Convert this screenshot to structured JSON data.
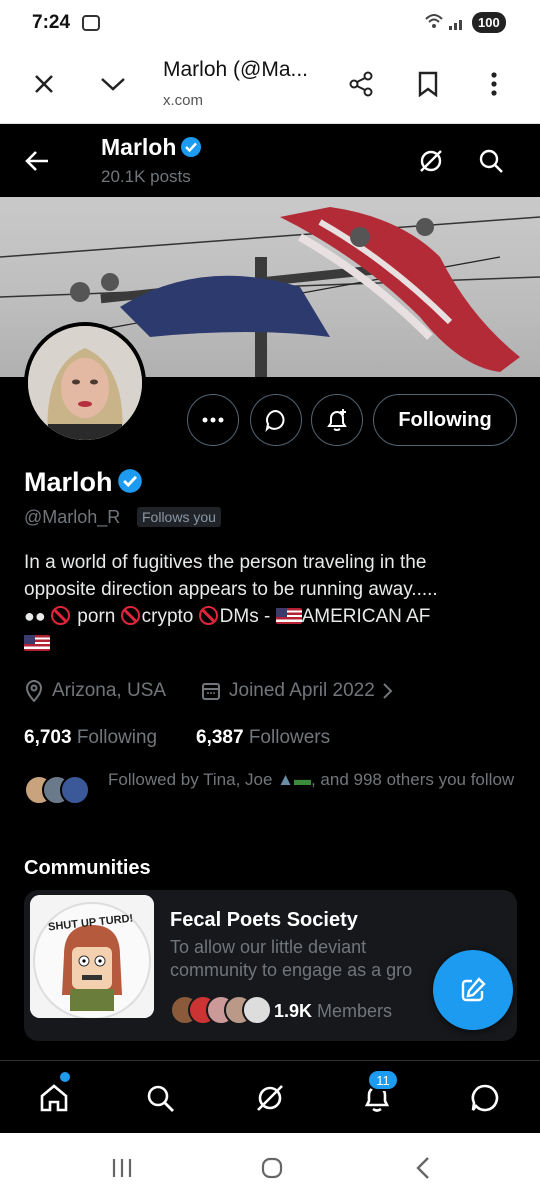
{
  "status_bar": {
    "time": "7:24",
    "battery": "100"
  },
  "browser": {
    "title": "Marloh (@Ma...",
    "url": "x.com"
  },
  "header": {
    "name": "Marloh",
    "posts": "20.1K posts"
  },
  "profile": {
    "name": "Marloh",
    "handle": "@Marloh_R",
    "follows_you": "Follows you",
    "following_button": "Following",
    "bio_line1": "In a world of fugitives the person traveling in the",
    "bio_line2": "opposite direction appears to be running away.....",
    "bio_porn": " porn ",
    "bio_crypto": "crypto ",
    "bio_dms": "DMs - ",
    "bio_american": "AMERICAN AF",
    "location": "Arizona, USA",
    "joined": "Joined April 2022",
    "following_count": "6,703",
    "following_label": "Following",
    "followers_count": "6,387",
    "followers_label": "Followers",
    "followed_by_prefix": "Followed by Tina, Joe ",
    "followed_by_suffix": ", and 998 others you follow"
  },
  "communities": {
    "heading": "Communities",
    "card": {
      "title": "Fecal Poets Society",
      "description_line1": "To allow our little deviant",
      "description_line2": "community to engage as a gro",
      "members_count": "1.9K",
      "members_label": "Members",
      "image_text": "SHUT UP TURD!"
    }
  },
  "bottom_nav": {
    "notifications_badge": "11"
  },
  "colors": {
    "accent": "#1d9bf0",
    "background": "#000000",
    "muted": "#71767b"
  }
}
